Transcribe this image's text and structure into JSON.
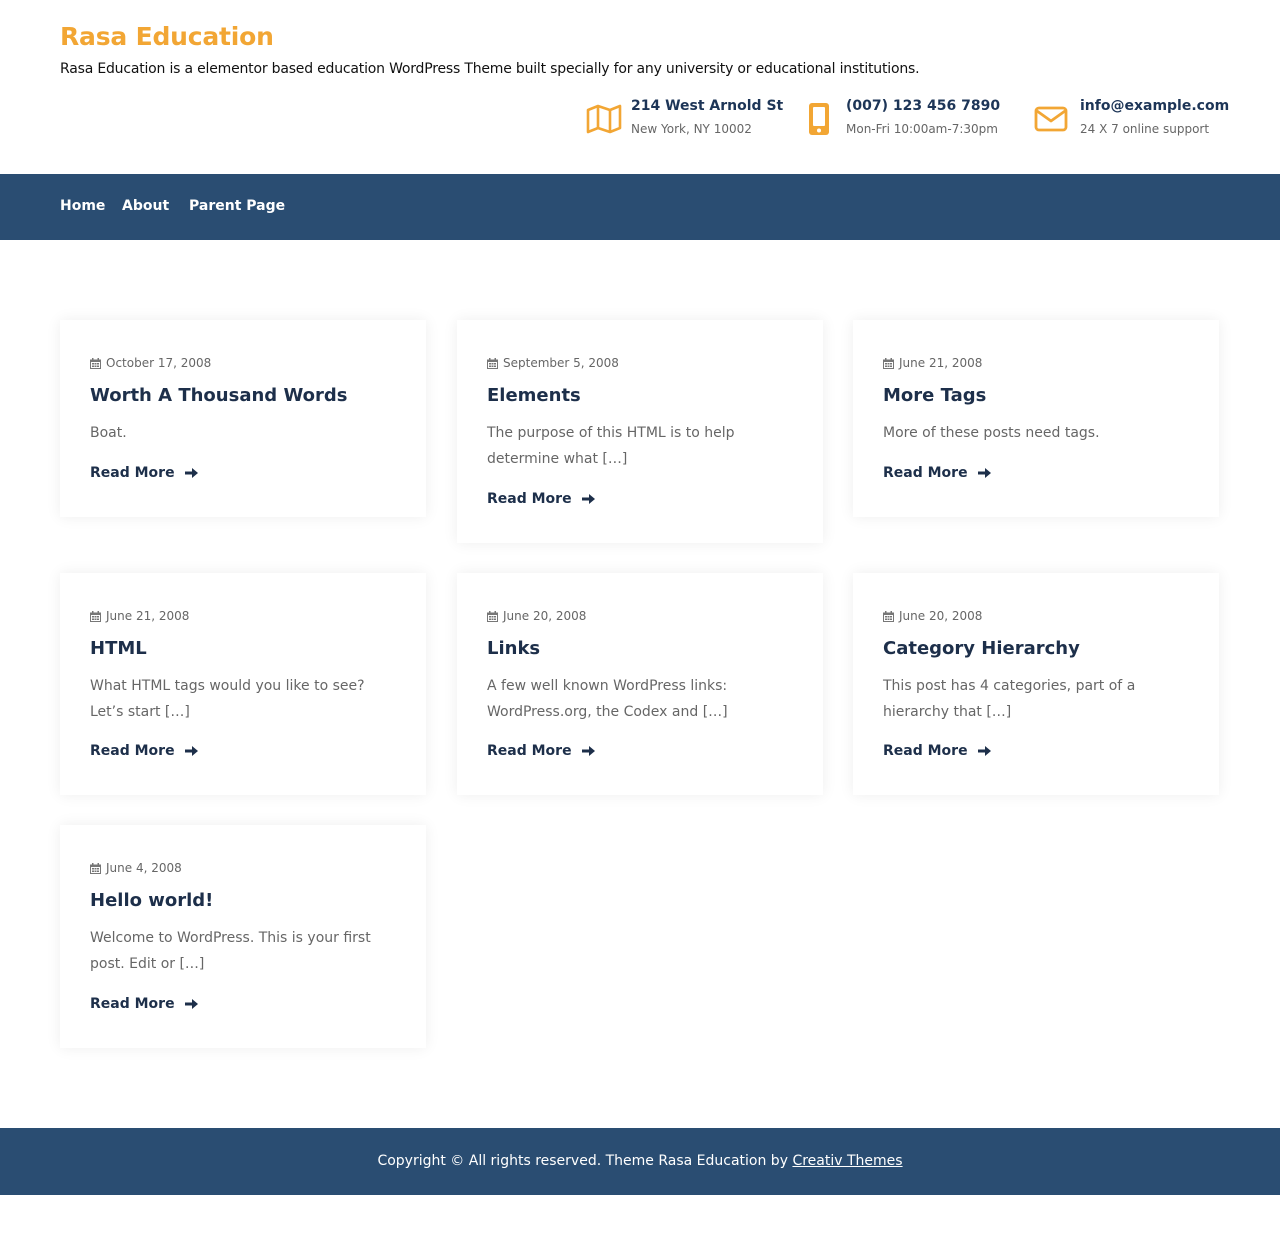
{
  "site": {
    "title": "Rasa Education",
    "description": "Rasa Education is a elementor based education WordPress Theme built specially for any university or educational institutions."
  },
  "contacts": [
    {
      "icon": "map-icon",
      "title": "214 West Arnold St",
      "subtitle": "New York, NY 10002"
    },
    {
      "icon": "mobile-phone-icon",
      "title": "(007) 123 456 7890",
      "subtitle": "Mon-Fri 10:00am-7:30pm"
    },
    {
      "icon": "envelope-icon",
      "title": "info@example.com",
      "subtitle": "24 X 7 online support"
    }
  ],
  "nav": {
    "items": [
      "Home",
      "About",
      "Parent Page"
    ]
  },
  "posts": [
    {
      "date": "October 17, 2008",
      "title": "Worth A Thousand Words",
      "excerpt": "Boat.",
      "read_more": "Read More"
    },
    {
      "date": "September 5, 2008",
      "title": "Elements",
      "excerpt": "The purpose of this HTML is to help determine what […]",
      "read_more": "Read More"
    },
    {
      "date": "June 21, 2008",
      "title": "More Tags",
      "excerpt": "More of these posts need tags.",
      "read_more": "Read More"
    },
    {
      "date": "June 21, 2008",
      "title": "HTML",
      "excerpt": "What HTML tags would you like to see? Let’s start […]",
      "read_more": "Read More"
    },
    {
      "date": "June 20, 2008",
      "title": "Links",
      "excerpt": "A few well known WordPress links: WordPress.org, the Codex and […]",
      "read_more": "Read More"
    },
    {
      "date": "June 20, 2008",
      "title": "Category Hierarchy",
      "excerpt": "This post has 4 categories, part of a hierarchy that […]",
      "read_more": "Read More"
    },
    {
      "date": "June 4, 2008",
      "title": "Hello world!",
      "excerpt": "Welcome to WordPress. This is your first post. Edit or […]",
      "read_more": "Read More"
    }
  ],
  "footer": {
    "copyright": "Copyright © All rights reserved. Theme Rasa Education by",
    "author_link": "Creativ Themes"
  },
  "colors": {
    "accent": "#f2a634",
    "nav_bg": "#2a4d72",
    "heading": "#1d2f4a"
  }
}
